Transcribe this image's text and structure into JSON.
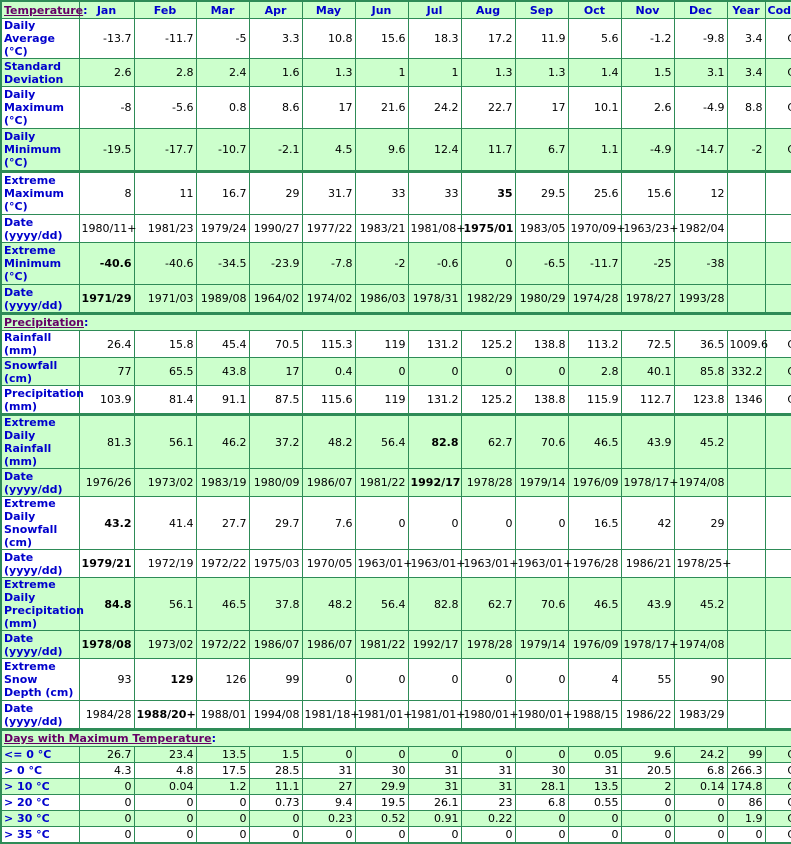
{
  "header": {
    "section_label": "Temperature",
    "colon": ":",
    "months": [
      "Jan",
      "Feb",
      "Mar",
      "Apr",
      "May",
      "Jun",
      "Jul",
      "Aug",
      "Sep",
      "Oct",
      "Nov",
      "Dec"
    ],
    "year_label": "Year",
    "code_label": "Code"
  },
  "sections": {
    "temperature": "Temperature",
    "precipitation": "Precipitation",
    "days_max_temp": "Days with Maximum Temperature"
  },
  "rows": [
    {
      "label": "Daily Average (°C)",
      "values": [
        "-13.7",
        "-11.7",
        "-5",
        "3.3",
        "10.8",
        "15.6",
        "18.3",
        "17.2",
        "11.9",
        "5.6",
        "-1.2",
        "-9.8"
      ],
      "year": "3.4",
      "code": "C",
      "bold": []
    },
    {
      "label": "Standard Deviation",
      "values": [
        "2.6",
        "2.8",
        "2.4",
        "1.6",
        "1.3",
        "1",
        "1",
        "1.3",
        "1.3",
        "1.4",
        "1.5",
        "3.1"
      ],
      "year": "3.4",
      "code": "C",
      "bold": []
    },
    {
      "label": "Daily Maximum (°C)",
      "values": [
        "-8",
        "-5.6",
        "0.8",
        "8.6",
        "17",
        "21.6",
        "24.2",
        "22.7",
        "17",
        "10.1",
        "2.6",
        "-4.9"
      ],
      "year": "8.8",
      "code": "C",
      "bold": []
    },
    {
      "label": "Daily Minimum (°C)",
      "values": [
        "-19.5",
        "-17.7",
        "-10.7",
        "-2.1",
        "4.5",
        "9.6",
        "12.4",
        "11.7",
        "6.7",
        "1.1",
        "-4.9",
        "-14.7"
      ],
      "year": "-2",
      "code": "C",
      "bold": []
    },
    {
      "label": "Extreme Maximum (°C)",
      "values": [
        "8",
        "11",
        "16.7",
        "29",
        "31.7",
        "33",
        "33",
        "35",
        "29.5",
        "25.6",
        "15.6",
        "12"
      ],
      "year": "",
      "code": "",
      "bold": [
        7
      ]
    },
    {
      "label": "Date (yyyy/dd)",
      "values": [
        "1980/11+",
        "1981/23",
        "1979/24",
        "1990/27",
        "1977/22",
        "1983/21",
        "1981/08+",
        "1975/01",
        "1983/05",
        "1970/09+",
        "1963/23+",
        "1982/04"
      ],
      "year": "",
      "code": "",
      "bold": [
        7
      ]
    },
    {
      "label": "Extreme Minimum (°C)",
      "values": [
        "-40.6",
        "-40.6",
        "-34.5",
        "-23.9",
        "-7.8",
        "-2",
        "-0.6",
        "0",
        "-6.5",
        "-11.7",
        "-25",
        "-38"
      ],
      "year": "",
      "code": "",
      "bold": [
        0
      ]
    },
    {
      "label": "Date (yyyy/dd)",
      "values": [
        "1971/29",
        "1971/03",
        "1989/08",
        "1964/02",
        "1974/02",
        "1986/03",
        "1978/31",
        "1982/29",
        "1980/29",
        "1974/28",
        "1978/27",
        "1993/28"
      ],
      "year": "",
      "code": "",
      "bold": [
        0
      ]
    },
    {
      "label": "Rainfall (mm)",
      "values": [
        "26.4",
        "15.8",
        "45.4",
        "70.5",
        "115.3",
        "119",
        "131.2",
        "125.2",
        "138.8",
        "113.2",
        "72.5",
        "36.5"
      ],
      "year": "1009.6",
      "code": "C",
      "bold": []
    },
    {
      "label": "Snowfall (cm)",
      "values": [
        "77",
        "65.5",
        "43.8",
        "17",
        "0.4",
        "0",
        "0",
        "0",
        "0",
        "2.8",
        "40.1",
        "85.8"
      ],
      "year": "332.2",
      "code": "C",
      "bold": []
    },
    {
      "label": "Precipitation (mm)",
      "values": [
        "103.9",
        "81.4",
        "91.1",
        "87.5",
        "115.6",
        "119",
        "131.2",
        "125.2",
        "138.8",
        "115.9",
        "112.7",
        "123.8"
      ],
      "year": "1346",
      "code": "C",
      "bold": []
    },
    {
      "label": "Extreme Daily Rainfall (mm)",
      "values": [
        "81.3",
        "56.1",
        "46.2",
        "37.2",
        "48.2",
        "56.4",
        "82.8",
        "62.7",
        "70.6",
        "46.5",
        "43.9",
        "45.2"
      ],
      "year": "",
      "code": "",
      "bold": [
        6
      ]
    },
    {
      "label": "Date (yyyy/dd)",
      "values": [
        "1976/26",
        "1973/02",
        "1983/19",
        "1980/09",
        "1986/07",
        "1981/22",
        "1992/17",
        "1978/28",
        "1979/14",
        "1976/09",
        "1978/17+",
        "1974/08"
      ],
      "year": "",
      "code": "",
      "bold": [
        6
      ]
    },
    {
      "label": "Extreme Daily Snowfall (cm)",
      "values": [
        "43.2",
        "41.4",
        "27.7",
        "29.7",
        "7.6",
        "0",
        "0",
        "0",
        "0",
        "16.5",
        "42",
        "29"
      ],
      "year": "",
      "code": "",
      "bold": [
        0
      ]
    },
    {
      "label": "Date (yyyy/dd)",
      "values": [
        "1979/21",
        "1972/19",
        "1972/22",
        "1975/03",
        "1970/05",
        "1963/01+",
        "1963/01+",
        "1963/01+",
        "1963/01+",
        "1976/28",
        "1986/21",
        "1978/25+"
      ],
      "year": "",
      "code": "",
      "bold": [
        0
      ]
    },
    {
      "label": "Extreme Daily Precipitation (mm)",
      "values": [
        "84.8",
        "56.1",
        "46.5",
        "37.8",
        "48.2",
        "56.4",
        "82.8",
        "62.7",
        "70.6",
        "46.5",
        "43.9",
        "45.2"
      ],
      "year": "",
      "code": "",
      "bold": [
        0
      ]
    },
    {
      "label": "Date (yyyy/dd)",
      "values": [
        "1978/08",
        "1973/02",
        "1972/22",
        "1986/07",
        "1986/07",
        "1981/22",
        "1992/17",
        "1978/28",
        "1979/14",
        "1976/09",
        "1978/17+",
        "1974/08"
      ],
      "year": "",
      "code": "",
      "bold": [
        0
      ]
    },
    {
      "label": "Extreme Snow Depth (cm)",
      "values": [
        "93",
        "129",
        "126",
        "99",
        "0",
        "0",
        "0",
        "0",
        "0",
        "4",
        "55",
        "90"
      ],
      "year": "",
      "code": "",
      "bold": [
        1
      ]
    },
    {
      "label": "Date (yyyy/dd)",
      "values": [
        "1984/28",
        "1988/20+",
        "1988/01",
        "1994/08",
        "1981/18+",
        "1981/01+",
        "1981/01+",
        "1980/01+",
        "1980/01+",
        "1988/15",
        "1986/22",
        "1983/29"
      ],
      "year": "",
      "code": "",
      "bold": [
        1
      ]
    },
    {
      "label": "<= 0 °C",
      "values": [
        "26.7",
        "23.4",
        "13.5",
        "1.5",
        "0",
        "0",
        "0",
        "0",
        "0",
        "0.05",
        "9.6",
        "24.2"
      ],
      "year": "99",
      "code": "C",
      "bold": []
    },
    {
      "label": "> 0 °C",
      "values": [
        "4.3",
        "4.8",
        "17.5",
        "28.5",
        "31",
        "30",
        "31",
        "31",
        "30",
        "31",
        "20.5",
        "6.8"
      ],
      "year": "266.3",
      "code": "C",
      "bold": []
    },
    {
      "label": "> 10 °C",
      "values": [
        "0",
        "0.04",
        "1.2",
        "11.1",
        "27",
        "29.9",
        "31",
        "31",
        "28.1",
        "13.5",
        "2",
        "0.14"
      ],
      "year": "174.8",
      "code": "C",
      "bold": []
    },
    {
      "label": "> 20 °C",
      "values": [
        "0",
        "0",
        "0",
        "0.73",
        "9.4",
        "19.5",
        "26.1",
        "23",
        "6.8",
        "0.55",
        "0",
        "0"
      ],
      "year": "86",
      "code": "C",
      "bold": []
    },
    {
      "label": "> 30 °C",
      "values": [
        "0",
        "0",
        "0",
        "0",
        "0.23",
        "0.52",
        "0.91",
        "0.22",
        "0",
        "0",
        "0",
        "0"
      ],
      "year": "1.9",
      "code": "C",
      "bold": []
    },
    {
      "label": "> 35 °C",
      "values": [
        "0",
        "0",
        "0",
        "0",
        "0",
        "0",
        "0",
        "0",
        "0",
        "0",
        "0",
        "0"
      ],
      "year": "0",
      "code": "C",
      "bold": []
    }
  ]
}
